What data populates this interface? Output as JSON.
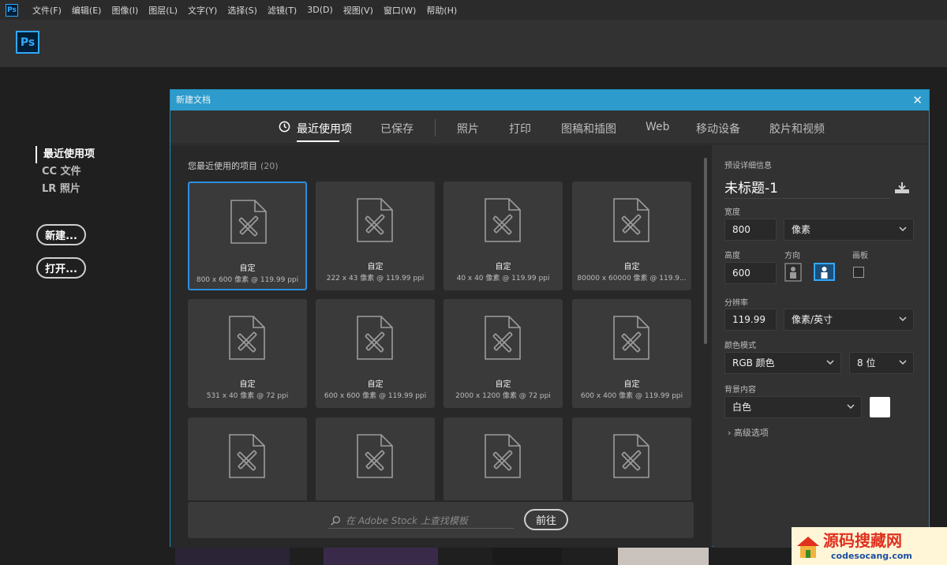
{
  "menubar": {
    "app_icon": "Ps",
    "items": [
      "文件(F)",
      "编辑(E)",
      "图像(I)",
      "图层(L)",
      "文字(Y)",
      "选择(S)",
      "滤镜(T)",
      "3D(D)",
      "视图(V)",
      "窗口(W)",
      "帮助(H)"
    ]
  },
  "home": {
    "logo": "Ps",
    "nav": [
      "最近使用项",
      "CC 文件",
      "LR 照片"
    ],
    "new_button": "新建...",
    "open_button": "打开..."
  },
  "dialog": {
    "title": "新建文档",
    "close": "✕",
    "tabs": [
      "最近使用项",
      "已保存",
      "照片",
      "打印",
      "图稿和插图",
      "Web",
      "移动设备",
      "胶片和视频"
    ],
    "recent_label": "您最近使用的项目",
    "recent_count": "(20)",
    "cards": [
      {
        "title": "自定",
        "sub": "800 x 600 像素 @ 119.99 ppi"
      },
      {
        "title": "自定",
        "sub": "222 x 43 像素 @ 119.99 ppi"
      },
      {
        "title": "自定",
        "sub": "40 x 40 像素 @ 119.99 ppi"
      },
      {
        "title": "自定",
        "sub": "80000 x 60000 像素 @ 119.9..."
      },
      {
        "title": "自定",
        "sub": "531 x 40 像素 @ 72 ppi"
      },
      {
        "title": "自定",
        "sub": "600 x 600 像素 @ 119.99 ppi"
      },
      {
        "title": "自定",
        "sub": "2000 x 1200 像素 @ 72 ppi"
      },
      {
        "title": "自定",
        "sub": "600 x 400 像素 @ 119.99 ppi"
      },
      {
        "title": "",
        "sub": ""
      },
      {
        "title": "",
        "sub": ""
      },
      {
        "title": "",
        "sub": ""
      },
      {
        "title": "",
        "sub": ""
      }
    ],
    "stock": {
      "placeholder": "在 Adobe Stock 上查找模板",
      "go_button": "前往"
    },
    "preset": {
      "section_label": "预设详细信息",
      "doc_name": "未标题-1",
      "width_label": "宽度",
      "width_value": "800",
      "width_unit": "像素",
      "height_label": "高度",
      "height_value": "600",
      "orientation_label": "方向",
      "artboard_label": "画板",
      "resolution_label": "分辨率",
      "resolution_value": "119.99",
      "resolution_unit": "像素/英寸",
      "color_mode_label": "颜色模式",
      "color_mode_value": "RGB 颜色",
      "bit_depth_value": "8 位",
      "background_label": "背景内容",
      "background_value": "白色",
      "background_color": "#ffffff",
      "advanced_label": "高级选项"
    }
  },
  "watermark": {
    "site_name": "源码搜藏网",
    "site_url": "codesocang.com"
  },
  "colors": {
    "accent": "#31a8ff",
    "dialog_title_bar": "#2d9bcb",
    "selected_card_border": "#2e8ee0"
  }
}
